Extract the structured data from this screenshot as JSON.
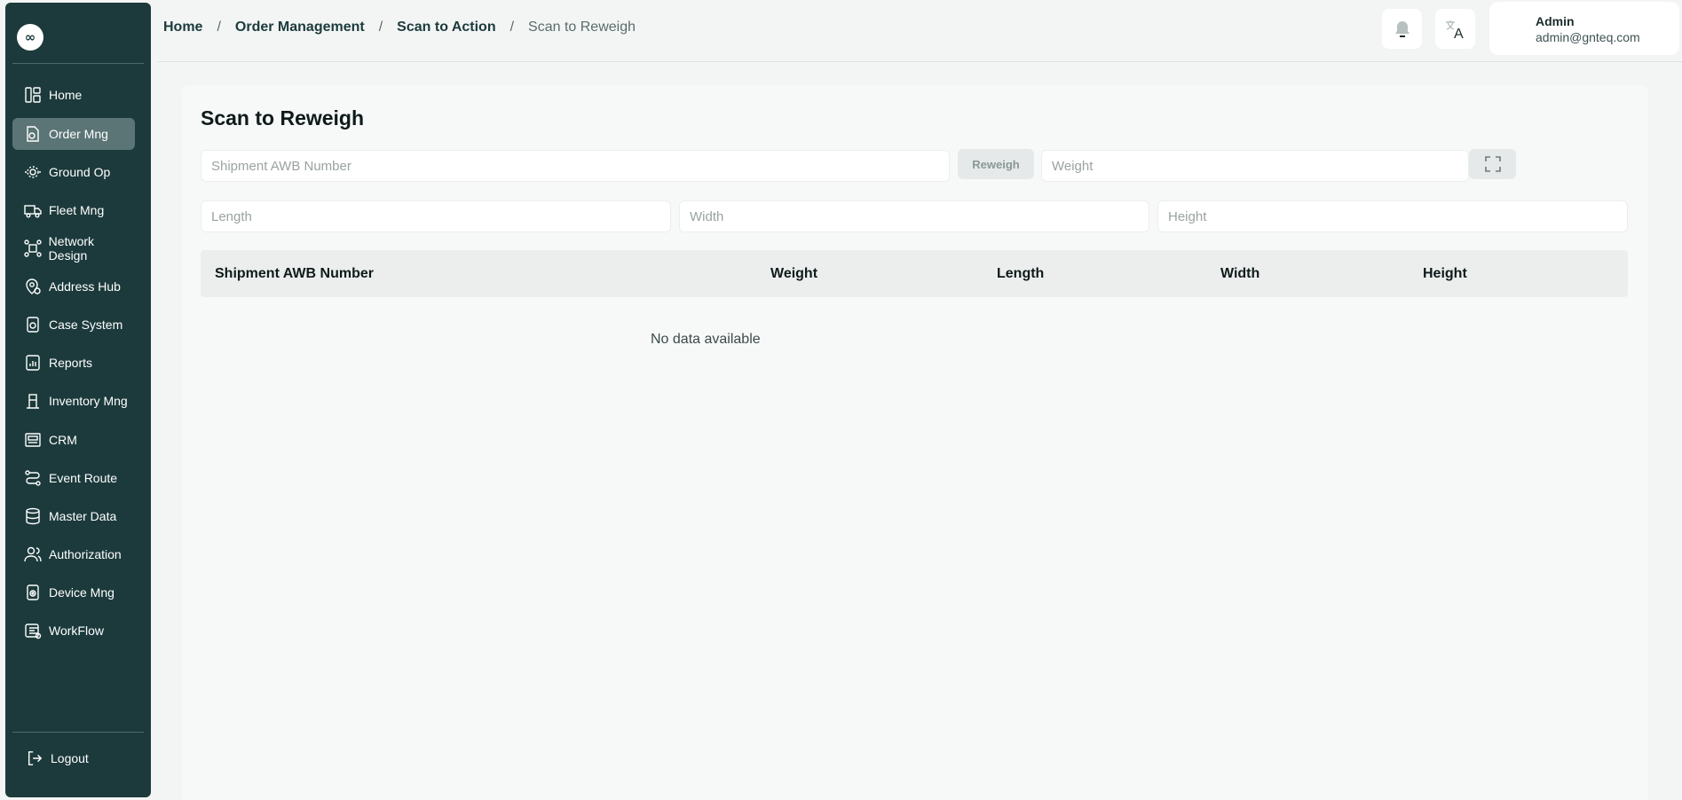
{
  "sidebar": {
    "logo_glyph": "∞",
    "items": [
      {
        "label": "Home",
        "icon": "home-icon",
        "active": false
      },
      {
        "label": "Order Mng",
        "icon": "order-icon",
        "active": true
      },
      {
        "label": "Ground Op",
        "icon": "ground-icon",
        "active": false
      },
      {
        "label": "Fleet Mng",
        "icon": "truck-icon",
        "active": false
      },
      {
        "label": "Network Design",
        "icon": "network-icon",
        "active": false
      },
      {
        "label": "Address Hub",
        "icon": "location-icon",
        "active": false
      },
      {
        "label": "Case System",
        "icon": "case-icon",
        "active": false
      },
      {
        "label": "Reports",
        "icon": "reports-icon",
        "active": false
      },
      {
        "label": "Inventory Mng",
        "icon": "inventory-icon",
        "active": false
      },
      {
        "label": "CRM",
        "icon": "crm-icon",
        "active": false
      },
      {
        "label": "Event Route",
        "icon": "route-icon",
        "active": false
      },
      {
        "label": "Master Data",
        "icon": "database-icon",
        "active": false
      },
      {
        "label": "Authorization",
        "icon": "users-icon",
        "active": false
      },
      {
        "label": "Device Mng",
        "icon": "device-icon",
        "active": false
      },
      {
        "label": "WorkFlow",
        "icon": "workflow-icon",
        "active": false
      }
    ],
    "logout_label": "Logout"
  },
  "header": {
    "breadcrumb": [
      "Home",
      "Order Management",
      "Scan to Action"
    ],
    "breadcrumb_sep": "/",
    "breadcrumb_current": "Scan to Reweigh",
    "user": {
      "name": "Admin",
      "email": "admin@gnteq.com"
    }
  },
  "main": {
    "title": "Scan to Reweigh",
    "awb_placeholder": "Shipment AWB Number",
    "reweigh_label": "Reweigh",
    "weight_placeholder": "Weight",
    "length_placeholder": "Length",
    "width_placeholder": "Width",
    "height_placeholder": "Height",
    "table": {
      "columns": [
        "Shipment AWB Number",
        "Weight",
        "Length",
        "Width",
        "Height"
      ],
      "empty_text": "No data available"
    }
  },
  "colors": {
    "sidebar_bg": "#1c3a3c",
    "sidebar_active": "#5b7576",
    "page_bg": "#f3f5f5"
  }
}
